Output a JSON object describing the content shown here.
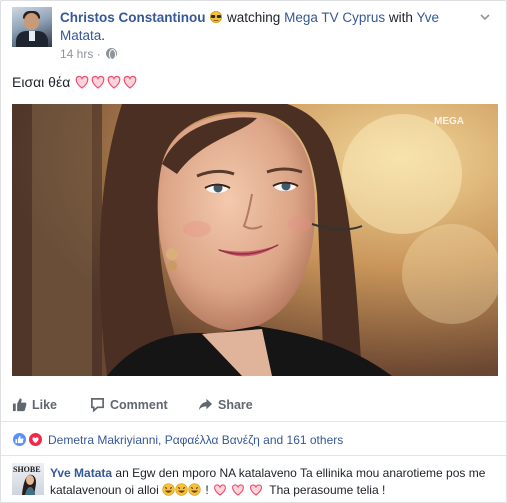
{
  "post": {
    "author": "Christos Constantinou",
    "activity_prefix": "watching",
    "page": "Mega TV Cyprus",
    "with_word": "with",
    "tagged": "Yve Matata",
    "period": ".",
    "time": "14 hrs",
    "time_separator": "·",
    "text": "Εισαι θέα",
    "image_logo": "MEGA"
  },
  "actions": {
    "like": "Like",
    "comment": "Comment",
    "share": "Share"
  },
  "reactions": {
    "names": "Demetra Makriyianni, Ραφαέλλα Βανέζη and 161 others"
  },
  "comment": {
    "author": "Yve Matata",
    "avatar_logo": "SHOBE",
    "text_1": "an Egw den mporo NA katalaveno Ta ellinika mou anarotieme pos me katalavenoun oi alloi",
    "sep": " ! ",
    "text_2": "Tha perasoume telia !"
  },
  "colors": {
    "link": "#365899",
    "meta": "#90949c",
    "heart": "#f04a6a",
    "like_blue": "#5890ff"
  }
}
